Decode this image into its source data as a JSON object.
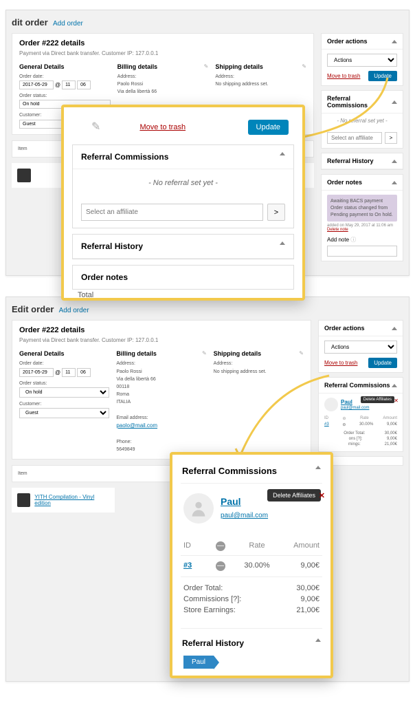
{
  "crumbs": {
    "edit": "dit order",
    "edit2": "Edit order",
    "add": "Add order"
  },
  "order": {
    "title": "Order #222 details",
    "sub": "Payment via Direct bank transfer. Customer IP: 127.0.0.1",
    "general": "General Details",
    "billing": "Billing details",
    "shipping": "Shipping details",
    "date_label": "Order date:",
    "date": "2017-05-29",
    "hh": "11",
    "mm": "06",
    "status_label": "Order status:",
    "status": "On hold",
    "customer_label": "Customer:",
    "customer": "Guest",
    "addr_label": "Address:",
    "addr_name": "Paolo Rossi",
    "addr_street": "Via della libertà 66",
    "addr_zip": "00118",
    "addr_city": "Roma",
    "addr_country": "ITALIA",
    "email_label": "Email address:",
    "email": "paolo@mail.com",
    "phone_label": "Phone:",
    "phone": "5649849",
    "ship_addr": "Address:",
    "ship_none": "No shipping address set.",
    "item_label": "Item",
    "item_name": "YITH Compilation - Vinyl edition",
    "total": "Total"
  },
  "actions": {
    "title": "Order actions",
    "select": "Actions",
    "trash": "Move to trash",
    "update": "Update"
  },
  "refcom": {
    "title": "Referral Commissions",
    "none": "- No referral set yet -",
    "placeholder": "Select an affiliate",
    "go": ">"
  },
  "refhist": {
    "title": "Referral History"
  },
  "notes": {
    "title": "Order notes",
    "body": "Awaiting BACS payment Order status changed from Pending payment to On hold.",
    "meta": "added on May 29, 2017 at 11:06 am",
    "del": "Delete note",
    "add": "Add note"
  },
  "aff": {
    "name": "Paul",
    "email": "paul@mail.com",
    "delete_tip": "Delete Affiliates",
    "col_id": "ID",
    "col_rate": "Rate",
    "col_amount": "Amount",
    "row_id": "#3",
    "row_rate": "30.00%",
    "row_amount": "9,00€",
    "sum_total_l": "Order Total:",
    "sum_total_v": "30,00€",
    "sum_com_l": "Commissions [?]:",
    "sum_com_v": "9,00€",
    "sum_earn_l": "Store Earnings:",
    "sum_earn_v": "21,00€",
    "mini_com_l": "ons [?]:",
    "mini_earn_l": "rnings:"
  }
}
